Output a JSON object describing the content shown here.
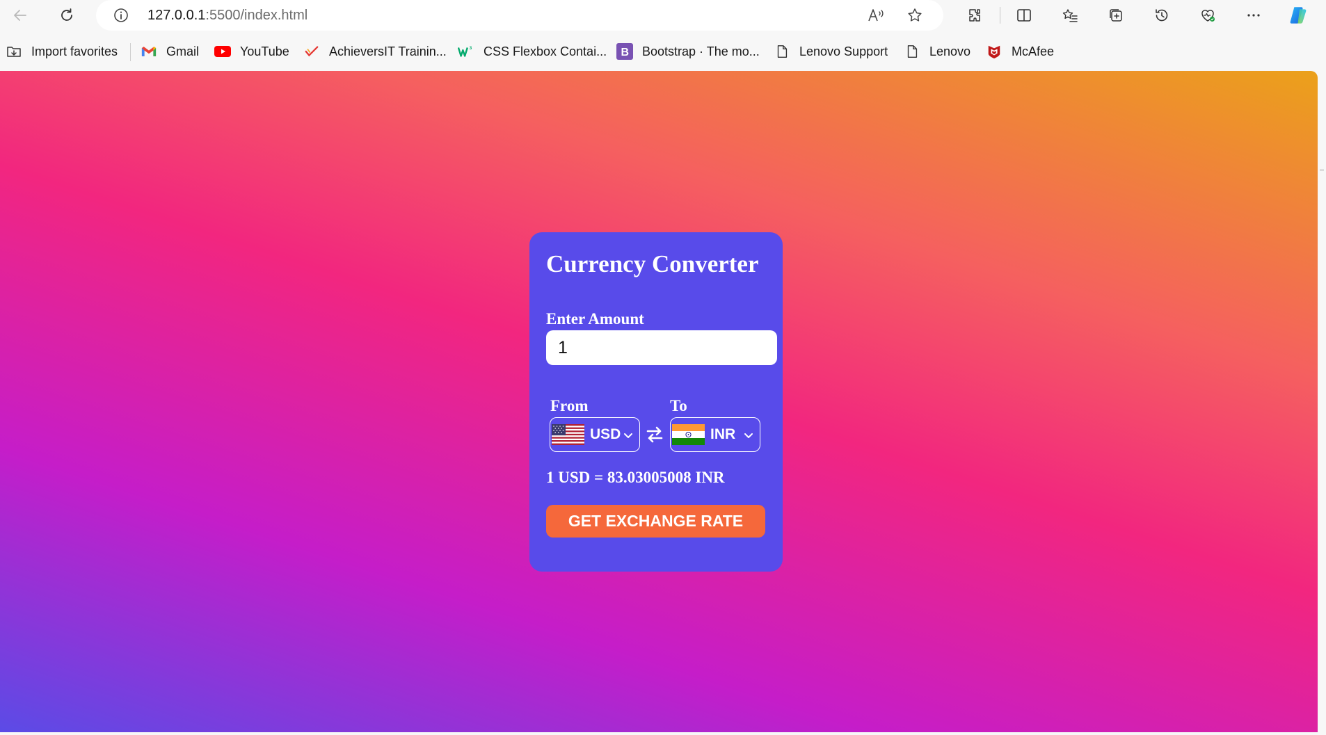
{
  "browser": {
    "url_host": "127.0.0.1",
    "url_path": ":5500/index.html",
    "icons": [
      "back-icon",
      "refresh-icon",
      "info-icon",
      "read-aloud-icon",
      "favorite-star-icon",
      "extensions-icon",
      "split-screen-icon",
      "favorites-icon",
      "collections-icon",
      "history-icon",
      "browser-essentials-icon",
      "more-icon",
      "copilot-icon"
    ]
  },
  "bookmarks": [
    {
      "label": "Import favorites",
      "icon": "import-icon"
    },
    {
      "label": "Gmail",
      "icon": "gmail-icon"
    },
    {
      "label": "YouTube",
      "icon": "youtube-icon"
    },
    {
      "label": "AchieversIT Trainin...",
      "icon": "achieversit-icon"
    },
    {
      "label": "CSS Flexbox Contai...",
      "icon": "w3schools-icon"
    },
    {
      "label": "Bootstrap · The mo...",
      "icon": "bootstrap-icon"
    },
    {
      "label": "Lenovo Support",
      "icon": "page-icon"
    },
    {
      "label": "Lenovo",
      "icon": "page-icon"
    },
    {
      "label": "McAfee",
      "icon": "mcafee-icon"
    }
  ],
  "converter": {
    "title": "Currency Converter",
    "amount_label": "Enter Amount",
    "amount_value": "1",
    "from_label": "From",
    "to_label": "To",
    "from_currency": "USD",
    "to_currency": "INR",
    "rate_text": "1 USD = 83.03005008 INR",
    "button_label": "GET EXCHANGE RATE"
  },
  "colors": {
    "card_bg": "#584bea",
    "button_bg": "#f5683b",
    "gradient": [
      "#5b4be6",
      "#c51dc9",
      "#f2267f",
      "#f5605f",
      "#eba11a"
    ]
  }
}
